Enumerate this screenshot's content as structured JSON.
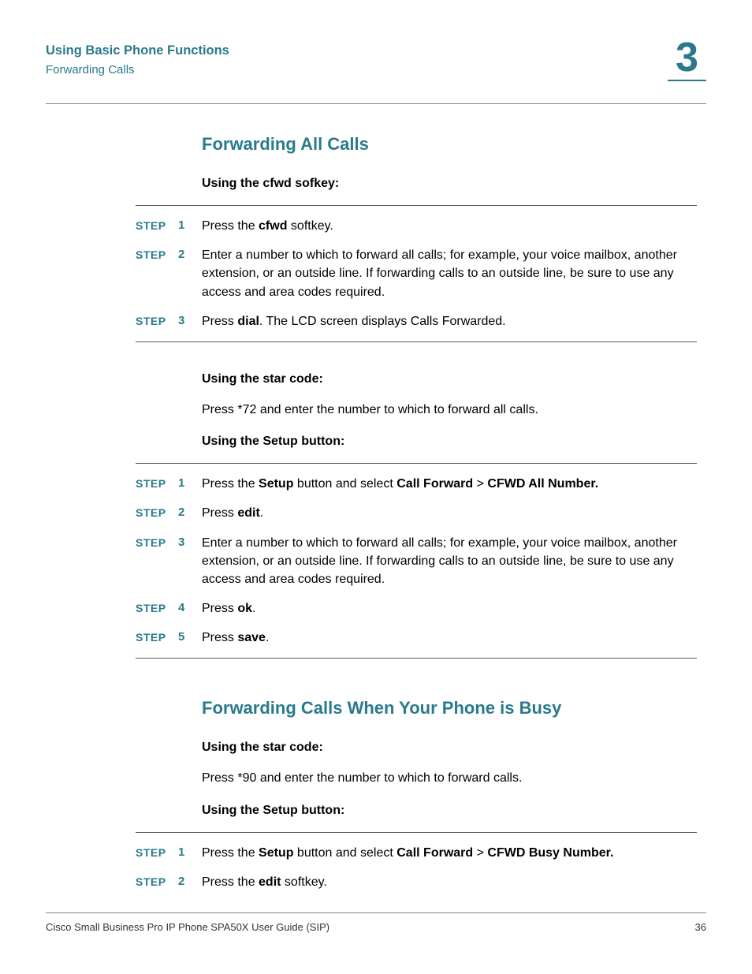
{
  "header": {
    "chapter_title": "Using Basic Phone Functions",
    "breadcrumb": "Forwarding Calls",
    "chapter_number": "3"
  },
  "section1": {
    "heading": "Forwarding All Calls",
    "sub1": "Using the cfwd sofkey:",
    "steps1": [
      {
        "label": "STEP",
        "num": "1",
        "html": "Press the <b>cfwd</b> softkey."
      },
      {
        "label": "STEP",
        "num": "2",
        "html": "Enter a number to which to forward all calls; for example, your voice mailbox, another extension, or an outside line. If forwarding calls to an outside line, be sure to use any access and area codes required."
      },
      {
        "label": "STEP",
        "num": "3",
        "html": "Press <b>dial</b>. The LCD screen displays Calls Forwarded."
      }
    ],
    "sub2": "Using the star code:",
    "body2": "Press *72 and enter the number to which to forward all calls.",
    "sub3": "Using the Setup button:",
    "steps3": [
      {
        "label": "STEP",
        "num": "1",
        "html": "Press the <b>Setup</b> button and select <b>Call Forward</b> > <b>CFWD All Number.</b>"
      },
      {
        "label": "STEP",
        "num": "2",
        "html": "Press <b>edit</b>."
      },
      {
        "label": "STEP",
        "num": "3",
        "html": "Enter a number to which to forward all calls; for example, your voice mailbox, another extension, or an outside line. If forwarding calls to an outside line, be sure to use any access and area codes required."
      },
      {
        "label": "STEP",
        "num": "4",
        "html": "Press <b>ok</b>."
      },
      {
        "label": "STEP",
        "num": "5",
        "html": "Press <b>save</b>."
      }
    ]
  },
  "section2": {
    "heading": "Forwarding Calls When Your Phone is Busy",
    "sub1": "Using the star code:",
    "body1": "Press *90 and enter the number to which to forward calls.",
    "sub2": "Using the Setup button:",
    "steps2": [
      {
        "label": "STEP",
        "num": "1",
        "html": "Press the <b>Setup</b> button and select <b>Call Forward</b> > <b>CFWD Busy Number.</b>"
      },
      {
        "label": "STEP",
        "num": "2",
        "html": "Press the <b>edit</b> softkey."
      }
    ]
  },
  "footer": {
    "left": "Cisco Small Business Pro IP Phone SPA50X User Guide (SIP)",
    "right": "36"
  }
}
